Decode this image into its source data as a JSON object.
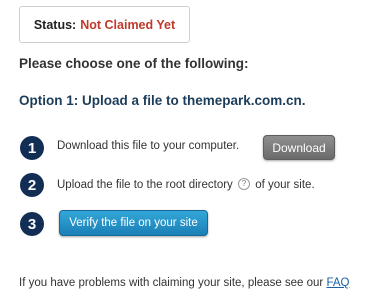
{
  "status": {
    "label": "Status:",
    "value": "Not Claimed Yet"
  },
  "heading": "Please choose one of the following:",
  "option": {
    "title": "Option 1: Upload a file to themepark.com.cn."
  },
  "steps": [
    {
      "number": "1",
      "text": "Download this file to your computer.",
      "button": "Download"
    },
    {
      "number": "2",
      "text_before": "Upload the file to the root directory",
      "help_icon": "?",
      "text_after": "of your site."
    },
    {
      "number": "3",
      "button": "Verify the file on your site"
    }
  ],
  "footer": {
    "text": "If you have problems with claiming your site, please see our",
    "link": "FAQ"
  },
  "colors": {
    "status_value": "#c0392b",
    "step_circle": "#132e55",
    "option_title": "#1c3d5a",
    "verify_button": "#1f8fc9",
    "download_button": "#7a7a7a"
  }
}
